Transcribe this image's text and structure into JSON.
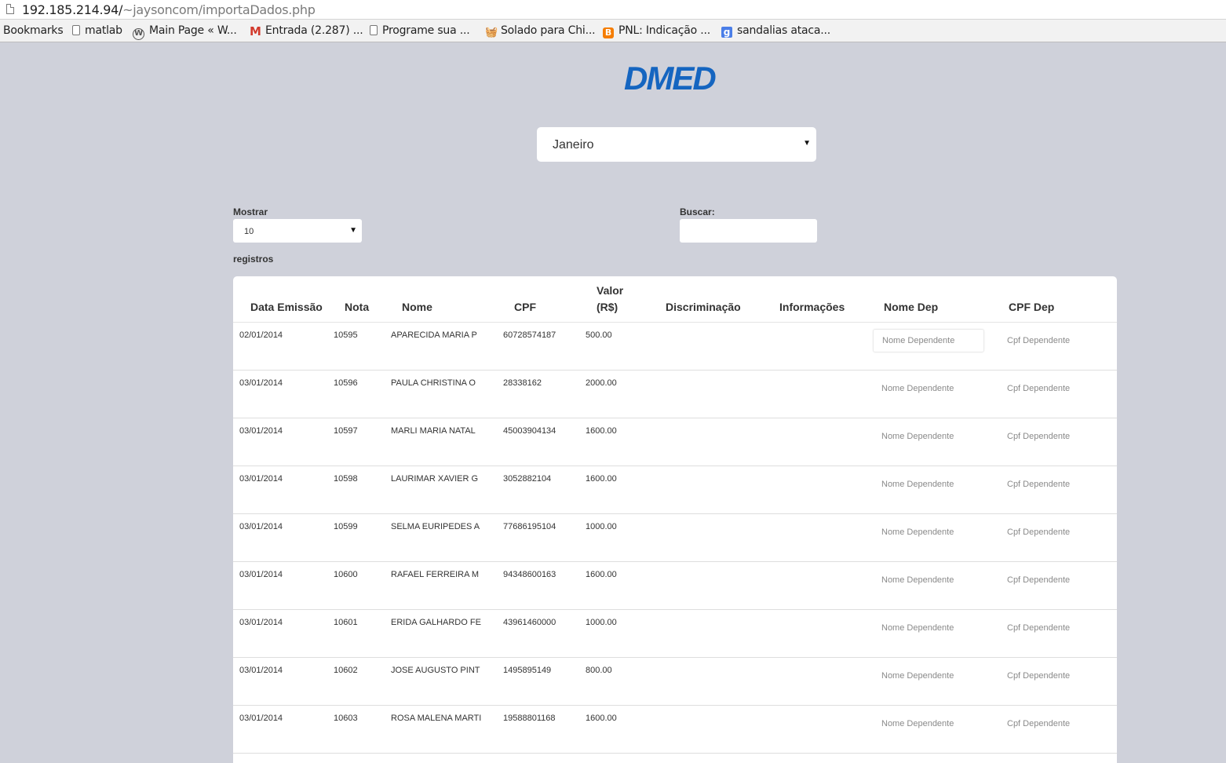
{
  "browser": {
    "url_host": "192.185.214.94/",
    "url_path": "~jaysoncom/importaDados.php",
    "bookmarks": [
      {
        "label": "Bookmarks",
        "icon": "none"
      },
      {
        "label": "matlab",
        "icon": "document-icon"
      },
      {
        "label": "Main Page « W...",
        "icon": "wordpress-icon"
      },
      {
        "label": "Entrada (2.287) ...",
        "icon": "gmail-icon"
      },
      {
        "label": "Programe sua ...",
        "icon": "document-icon"
      },
      {
        "label": "Solado para Chi...",
        "icon": "basket-icon"
      },
      {
        "label": "PNL: Indicação ...",
        "icon": "blogger-icon"
      },
      {
        "label": "sandalias ataca...",
        "icon": "google-icon"
      }
    ]
  },
  "logo": {
    "text": "DMED",
    "color": "#1565c0"
  },
  "month_select": {
    "value": "Janeiro"
  },
  "table_controls": {
    "length_label": "Mostrar",
    "length_value": "10",
    "length_suffix": "registros",
    "search_label": "Buscar:",
    "search_value": ""
  },
  "table": {
    "columns": [
      "Data Emissão",
      "Nota",
      "Nome",
      "CPF",
      "Valor (R$)",
      "Discriminação",
      "Informações",
      "Nome Dep",
      "CPF Dep"
    ],
    "placeholder_nome_dep": "Nome Dependente",
    "placeholder_cpf_dep": "Cpf Dependente",
    "rows": [
      {
        "data": "02/01/2014",
        "nota": "10595",
        "nome": "APARECIDA MARIA P",
        "cpf": "60728574187",
        "valor": "500.00"
      },
      {
        "data": "03/01/2014",
        "nota": "10596",
        "nome": "PAULA CHRISTINA O",
        "cpf": "28338162",
        "valor": "2000.00"
      },
      {
        "data": "03/01/2014",
        "nota": "10597",
        "nome": "MARLI MARIA NATAL",
        "cpf": "45003904134",
        "valor": "1600.00"
      },
      {
        "data": "03/01/2014",
        "nota": "10598",
        "nome": "LAURIMAR XAVIER G",
        "cpf": "3052882104",
        "valor": "1600.00"
      },
      {
        "data": "03/01/2014",
        "nota": "10599",
        "nome": "SELMA EURIPEDES A",
        "cpf": "77686195104",
        "valor": "1000.00"
      },
      {
        "data": "03/01/2014",
        "nota": "10600",
        "nome": "RAFAEL FERREIRA M",
        "cpf": "94348600163",
        "valor": "1600.00"
      },
      {
        "data": "03/01/2014",
        "nota": "10601",
        "nome": "ERIDA GALHARDO FE",
        "cpf": "43961460000",
        "valor": "1000.00"
      },
      {
        "data": "03/01/2014",
        "nota": "10602",
        "nome": "JOSE AUGUSTO PINT",
        "cpf": "1495895149",
        "valor": "800.00"
      },
      {
        "data": "03/01/2014",
        "nota": "10603",
        "nome": "ROSA MALENA MARTI",
        "cpf": "19588801168",
        "valor": "1600.00"
      }
    ]
  }
}
